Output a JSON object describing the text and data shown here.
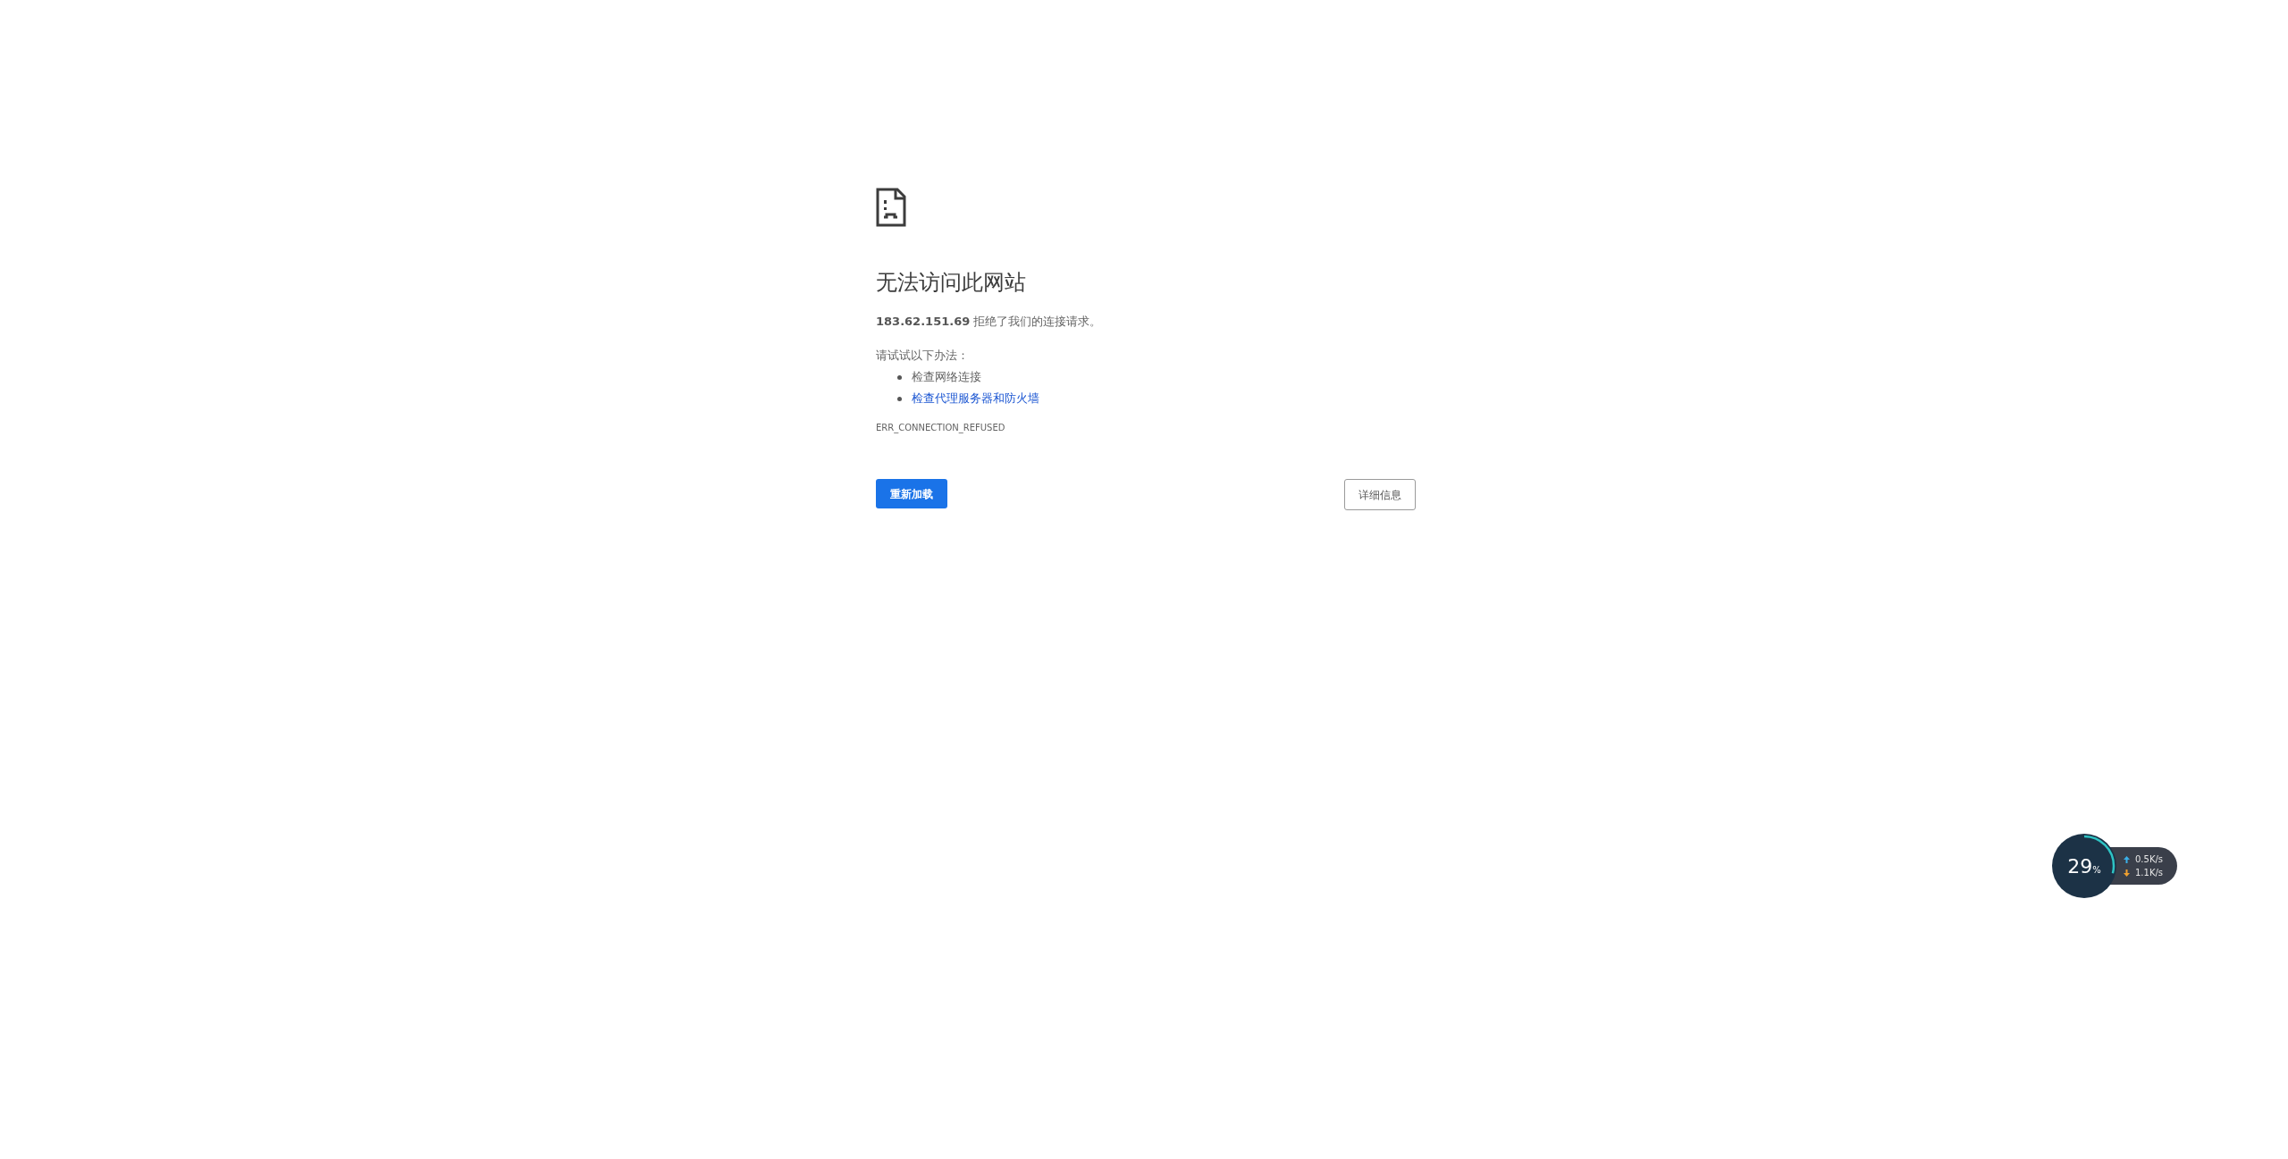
{
  "error_page": {
    "title": "无法访问此网站",
    "host": "183.62.151.69",
    "message": "拒绝了我们的连接请求。",
    "suggestions_heading": "请试试以下办法：",
    "suggestions": [
      {
        "text": "检查网络连接",
        "kind": "text"
      },
      {
        "text": "检查代理服务器和防火墙",
        "kind": "link"
      }
    ],
    "error_code": "ERR_CONNECTION_REFUSED",
    "reload_button": "重新加载",
    "details_button": "详细信息"
  },
  "speed_widget": {
    "percent": "29",
    "unit": "%",
    "upload": "0.5K/s",
    "download": "1.1K/s"
  }
}
